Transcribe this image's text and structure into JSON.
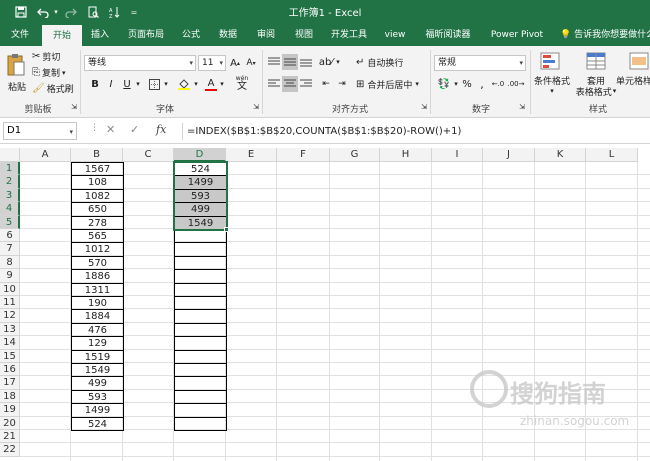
{
  "titlebar": {
    "title": "工作簿1 - Excel",
    "save_icon": "save-icon",
    "undo_icon": "undo-icon",
    "redo_icon": "redo-icon",
    "preview_icon": "print-preview-icon",
    "sort_icon": "sort-icon",
    "customize_icon": "customize-qat-icon"
  },
  "tabs": [
    {
      "label": "文件"
    },
    {
      "label": "开始"
    },
    {
      "label": "插入"
    },
    {
      "label": "页面布局"
    },
    {
      "label": "公式"
    },
    {
      "label": "数据"
    },
    {
      "label": "审阅"
    },
    {
      "label": "视图"
    },
    {
      "label": "开发工具"
    },
    {
      "label": "view"
    },
    {
      "label": "福昕阅读器"
    },
    {
      "label": "Power Pivot"
    }
  ],
  "tell_me": "告诉我你想要做什么",
  "ribbon": {
    "clipboard": {
      "paste": "粘贴",
      "cut": "剪切",
      "copy": "复制",
      "format_painter": "格式刷",
      "label": "剪贴板"
    },
    "font": {
      "name": "等线",
      "size": "11",
      "bold": "B",
      "italic": "I",
      "underline": "U",
      "label": "字体",
      "font_color": "#ff0000",
      "fill_color": "#ffff00",
      "wen": "wén"
    },
    "alignment": {
      "wrap": "自动换行",
      "merge": "合并后居中",
      "label": "对齐方式"
    },
    "number": {
      "format": "常规",
      "percent": "%",
      "comma": ",",
      "label": "数字"
    },
    "styles": {
      "conditional": "条件格式",
      "table1": "套用",
      "table2": "表格格式",
      "cell_styles": "单元格样",
      "label": "样式"
    }
  },
  "formula_bar": {
    "name_box": "D1",
    "fx": "fx",
    "formula": "=INDEX($B$1:$B$20,COUNTA($B$1:$B$20)-ROW()+1)"
  },
  "columns": [
    "A",
    "B",
    "C",
    "D",
    "E",
    "F",
    "G",
    "H",
    "I",
    "J",
    "K",
    "L"
  ],
  "rows": [
    "1",
    "2",
    "3",
    "4",
    "5",
    "6",
    "7",
    "8",
    "9",
    "10",
    "11",
    "12",
    "13",
    "14",
    "15",
    "16",
    "17",
    "18",
    "19",
    "20",
    "21",
    "22"
  ],
  "column_b": [
    "1567",
    "108",
    "1082",
    "650",
    "278",
    "565",
    "1012",
    "570",
    "1886",
    "1311",
    "190",
    "1884",
    "476",
    "129",
    "1519",
    "1549",
    "499",
    "593",
    "1499",
    "524"
  ],
  "column_d": [
    "524",
    "1499",
    "593",
    "499",
    "1549",
    "",
    "",
    "",
    "",
    "",
    "",
    "",
    "",
    "",
    "",
    "",
    "",
    "",
    "",
    ""
  ],
  "watermark": {
    "text": "搜狗指南",
    "url": "zhinan.sogou.com"
  },
  "colors": {
    "excel_green": "#217346",
    "selection_fill": "#c8c8c8"
  }
}
